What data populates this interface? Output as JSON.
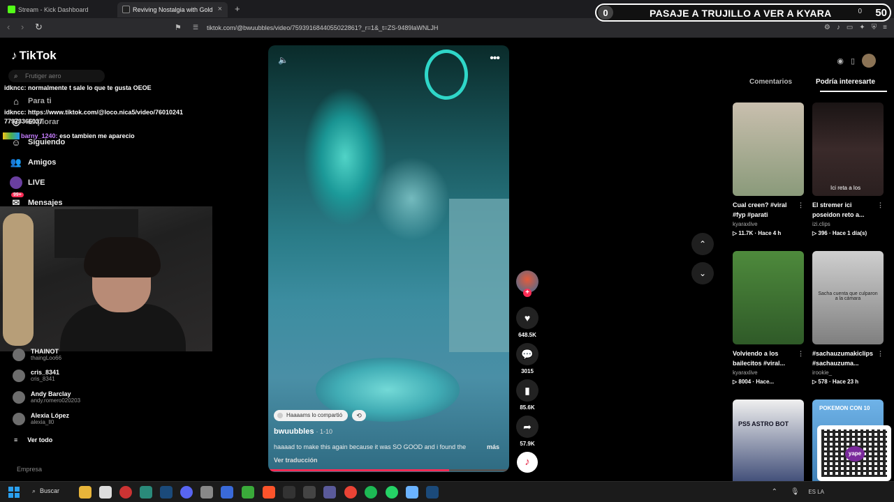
{
  "browser": {
    "tabs": [
      {
        "label": "Stream - Kick Dashboard",
        "color": "#53fc18"
      },
      {
        "label": "Reviving Nostalgia with Gold",
        "color": "#ffffff"
      }
    ],
    "url": "tiktok.com/@bwuubbles/video/7593916844055022861?_r=1&_t=ZS-9489laWNLJH"
  },
  "banner": {
    "left_count": "0",
    "text": "PASAJE A TRUJILLO A VER A KYARA",
    "small": "0",
    "right_count": "50"
  },
  "sidebar": {
    "logo": "TikTok",
    "search_placeholder": "Frutiger aero",
    "nav": [
      {
        "label": "Para ti",
        "icon": "home-icon"
      },
      {
        "label": "Explorar",
        "icon": "compass-icon"
      },
      {
        "label": "Siguiendo",
        "icon": "following-icon"
      },
      {
        "label": "Amigos",
        "icon": "friends-icon"
      },
      {
        "label": "LIVE",
        "icon": "live-icon"
      },
      {
        "label": "Mensajes",
        "icon": "messages-icon",
        "badge": "99+"
      }
    ],
    "following": [
      {
        "name": "THAINOT",
        "handle": "thaingLoo66"
      },
      {
        "name": "cris_8341",
        "handle": "cris_8341"
      },
      {
        "name": "Andy Barclay",
        "handle": "andy.romero020203"
      },
      {
        "name": "Alexia López",
        "handle": "alexia_ll0"
      }
    ],
    "see_all": "Ver todo",
    "footer": "Empresa"
  },
  "chat": [
    {
      "user": "idkncc:",
      "text": "normalmente t sale lo que te gusta OEOE"
    },
    {
      "user": "idkncc:",
      "text": "https://www.tiktok.com/@loco.nica5/video/76010241"
    },
    {
      "user": "",
      "text": "77973366037"
    },
    {
      "user": "barny_1240:",
      "text": "eso tambien me aparecio"
    }
  ],
  "video": {
    "shared_label": "Haaaams lo compartió",
    "author": "bwuubbles",
    "date": "· 1-10",
    "caption": "haaaad to make this again because it was SO GOOD and i found the",
    "more": "más",
    "translate": "Ver traducción",
    "progress": 0.75
  },
  "actions": {
    "likes": "648.5K",
    "comments": "3015",
    "saves": "85.6K",
    "shares": "57.9K"
  },
  "right_panel": {
    "tabs": [
      "Comentarios",
      "Podría interesarte"
    ],
    "active_tab": 1,
    "cards": [
      {
        "title": "Cual creen? #viral #fyp #parati",
        "user": "kyaraxlive",
        "stats": "▷ 11.7K · Hace 4 h",
        "bg": "#a9b5a0"
      },
      {
        "title": "El stremer ici poseidon reto a...",
        "user": "izi.clips",
        "stats": "▷ 396 · Hace 1 día(s)",
        "bg": "#2b1d1d",
        "overlay": "Ici reta a los"
      },
      {
        "title": "Volviendo a los bailecitos #viral...",
        "user": "kyaraxlive",
        "stats": "▷ 8004 · Hace...",
        "bg": "#3d6b35"
      },
      {
        "title": "#sachauzumakiclips #sachauzuma...",
        "user": "irookie_",
        "stats": "▷ 578 · Hace 23 h",
        "bg": "#9a9a9a",
        "overlay": "Sacha cuenta que culparon a la cámara"
      },
      {
        "title": "",
        "user": "",
        "stats": "",
        "bg": "#d9dde3",
        "overlay": "PS5 ASTRO BOT"
      },
      {
        "title": "",
        "user": "",
        "stats": "",
        "bg": "#5aa0d9",
        "overlay": "POKEMON CON 10"
      }
    ]
  },
  "qr": {
    "label": "yape"
  },
  "taskbar": {
    "search": "Buscar",
    "tray": "ES LA"
  }
}
